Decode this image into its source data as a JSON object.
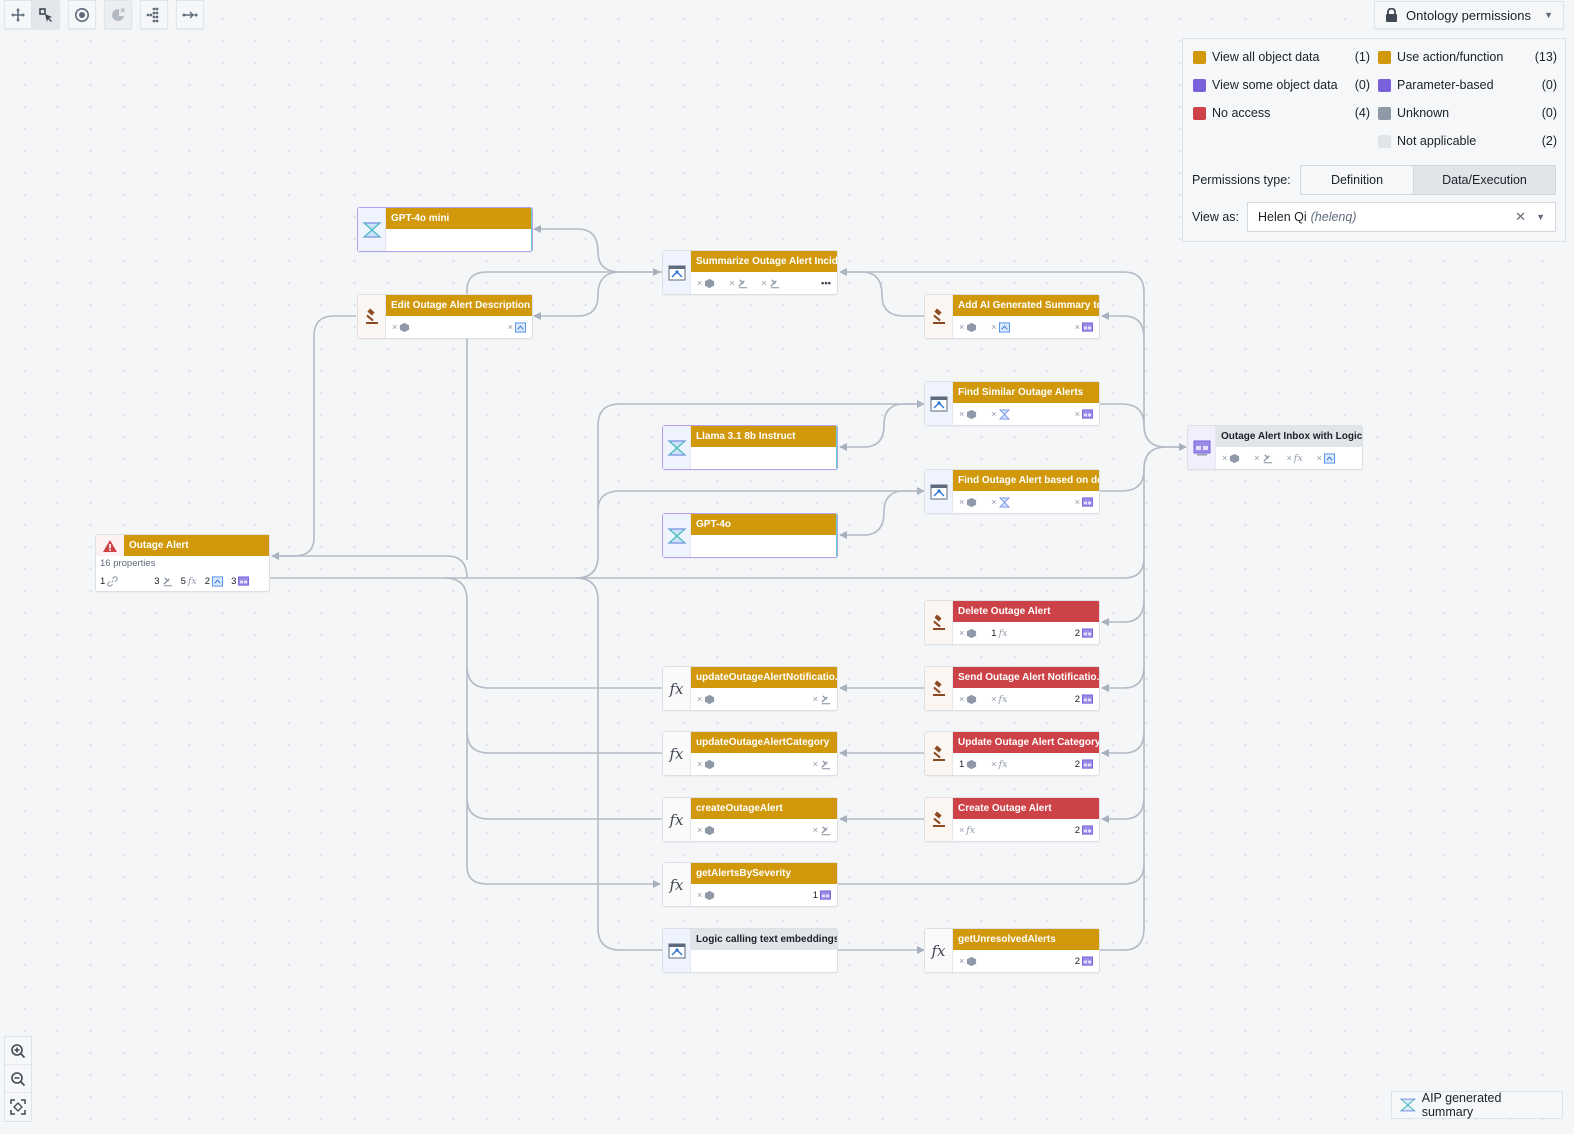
{
  "toolbar": {
    "buttons": [
      {
        "icon": "move-icon",
        "active": false
      },
      {
        "icon": "select-icon",
        "active": true
      },
      {
        "icon": "focus-icon",
        "active": false
      },
      {
        "icon": "hide-icon",
        "active": false,
        "disabled": true
      },
      {
        "icon": "layout-icon",
        "active": false
      },
      {
        "icon": "expand-icon",
        "active": false
      }
    ]
  },
  "permissions_dropdown": {
    "label": "Ontology permissions",
    "icon": "lock-icon"
  },
  "legend": {
    "colors": {
      "view_all": "#d1980b",
      "view_some": "#7961db",
      "no_access": "#cd4246",
      "unknown": "#8f99a8",
      "not_applicable": "#e1e4e8"
    },
    "left": [
      {
        "label": "View all object data",
        "count": "(1)",
        "color": "#d1980b"
      },
      {
        "label": "View some object data",
        "count": "(0)",
        "color": "#7961db"
      },
      {
        "label": "No access",
        "count": "(4)",
        "color": "#cd4246"
      }
    ],
    "right": [
      {
        "label": "Use action/function",
        "count": "(13)",
        "color": "#d1980b"
      },
      {
        "label": "Parameter-based",
        "count": "(0)",
        "color": "#7961db"
      },
      {
        "label": "Unknown",
        "count": "(0)",
        "color": "#8f99a8"
      },
      {
        "label": "Not applicable",
        "count": "(2)",
        "color": "#e1e4e8"
      }
    ],
    "permissions_type_label": "Permissions type:",
    "permissions_type_options": [
      "Definition",
      "Data/Execution"
    ],
    "permissions_type_selected": "Data/Execution",
    "view_as_label": "View as:",
    "view_as_name": "Helen Qi",
    "view_as_handle": "(helenq)"
  },
  "nodes": {
    "gpt4o_mini": {
      "title": "GPT-4o mini",
      "type": "model",
      "status": "view_all"
    },
    "edit_desc": {
      "title": "Edit Outage Alert Description ...",
      "type": "action",
      "status": "use",
      "footer": [
        {
          "icon": "object-icon",
          "val": "×"
        }
      ],
      "right": {
        "icon": "logic-icon",
        "val": "×"
      }
    },
    "summarize": {
      "title": "Summarize Outage Alert Incid...",
      "type": "logic",
      "status": "use",
      "footer": [
        {
          "icon": "object-icon",
          "val": "×"
        },
        {
          "icon": "action-icon",
          "val": "×"
        },
        {
          "icon": "action-icon",
          "val": "×"
        }
      ],
      "more": "•••"
    },
    "add_ai": {
      "title": "Add AI Generated Summary to...",
      "type": "action",
      "status": "use",
      "footer": [
        {
          "icon": "object-icon",
          "val": "×"
        },
        {
          "icon": "logic-icon",
          "val": "×"
        }
      ],
      "right": {
        "icon": "app-icon",
        "val": "×"
      }
    },
    "find_similar": {
      "title": "Find Similar Outage Alerts",
      "type": "logic",
      "status": "use",
      "footer": [
        {
          "icon": "object-icon",
          "val": "×"
        },
        {
          "icon": "model-icon",
          "val": "×"
        }
      ],
      "right": {
        "icon": "app-icon",
        "val": "×"
      }
    },
    "llama": {
      "title": "Llama 3.1 8b Instruct",
      "type": "model",
      "status": "view_all"
    },
    "find_based": {
      "title": "Find Outage Alert based on de...",
      "type": "logic",
      "status": "use",
      "footer": [
        {
          "icon": "object-icon",
          "val": "×"
        },
        {
          "icon": "model-icon",
          "val": "×"
        }
      ],
      "right": {
        "icon": "app-icon",
        "val": "×"
      }
    },
    "gpt4o": {
      "title": "GPT-4o",
      "type": "model",
      "status": "view_all"
    },
    "inbox": {
      "title": "Outage Alert Inbox with Logic",
      "type": "app",
      "status": "not_applicable",
      "footer": [
        {
          "icon": "object-icon",
          "val": "×"
        },
        {
          "icon": "action-icon",
          "val": "×"
        },
        {
          "icon": "function-icon",
          "val": "×"
        },
        {
          "icon": "logic-icon",
          "val": "×"
        }
      ]
    },
    "outage_alert": {
      "title": "Outage Alert",
      "type": "object",
      "status": "view_all",
      "properties": "16 properties",
      "stats": [
        {
          "icon": "link-icon",
          "val": "1"
        },
        {
          "icon": "action-icon",
          "val": "3"
        },
        {
          "icon": "function-icon",
          "val": "5"
        },
        {
          "icon": "logic-icon",
          "val": "2"
        },
        {
          "icon": "app-icon",
          "val": "3"
        }
      ]
    },
    "delete": {
      "title": "Delete Outage Alert",
      "type": "action",
      "status": "no_access",
      "footer": [
        {
          "icon": "object-icon",
          "val": "×"
        },
        {
          "icon": "function-icon",
          "val": "1"
        }
      ],
      "right": {
        "icon": "app-icon",
        "val": "2"
      }
    },
    "update_notif_fn": {
      "title": "updateOutageAlertNotificatio...",
      "type": "function",
      "status": "use",
      "footer": [
        {
          "icon": "object-icon",
          "val": "×"
        }
      ],
      "right": {
        "icon": "action-icon",
        "val": "×"
      }
    },
    "send_notif": {
      "title": "Send Outage Alert Notificatio...",
      "type": "action",
      "status": "no_access",
      "footer": [
        {
          "icon": "object-icon",
          "val": "×"
        },
        {
          "icon": "function-icon",
          "val": "×"
        }
      ],
      "right": {
        "icon": "app-icon",
        "val": "2"
      }
    },
    "update_cat_fn": {
      "title": "updateOutageAlertCategory",
      "type": "function",
      "status": "use",
      "footer": [
        {
          "icon": "object-icon",
          "val": "×"
        }
      ],
      "right": {
        "icon": "action-icon",
        "val": "×"
      }
    },
    "update_cat": {
      "title": "Update Outage Alert Category",
      "type": "action",
      "status": "no_access",
      "footer": [
        {
          "icon": "object-icon",
          "val": "1"
        },
        {
          "icon": "function-icon",
          "val": "×"
        }
      ],
      "right": {
        "icon": "app-icon",
        "val": "2"
      }
    },
    "create_fn": {
      "title": "createOutageAlert",
      "type": "function",
      "status": "use",
      "footer": [
        {
          "icon": "object-icon",
          "val": "×"
        }
      ],
      "right": {
        "icon": "action-icon",
        "val": "×"
      }
    },
    "create": {
      "title": "Create Outage Alert",
      "type": "action",
      "status": "no_access",
      "footer": [
        {
          "icon": "function-icon",
          "val": "×"
        }
      ],
      "right": {
        "icon": "app-icon",
        "val": "2"
      }
    },
    "get_sev": {
      "title": "getAlertsBySeverity",
      "type": "function",
      "status": "use",
      "footer": [
        {
          "icon": "object-icon",
          "val": "×"
        }
      ],
      "right": {
        "icon": "app-icon",
        "val": "1"
      }
    },
    "logic_embed": {
      "title": "Logic calling text embeddings",
      "type": "logic",
      "status": "not_applicable"
    },
    "get_unres": {
      "title": "getUnresolvedAlerts",
      "type": "function",
      "status": "use",
      "footer": [
        {
          "icon": "object-icon",
          "val": "×"
        }
      ],
      "right": {
        "icon": "app-icon",
        "val": "2"
      }
    }
  },
  "zoom_controls": [
    "zoom-in-icon",
    "zoom-out-icon",
    "fit-view-icon"
  ],
  "aip_summary": {
    "label": "AIP generated summary"
  }
}
